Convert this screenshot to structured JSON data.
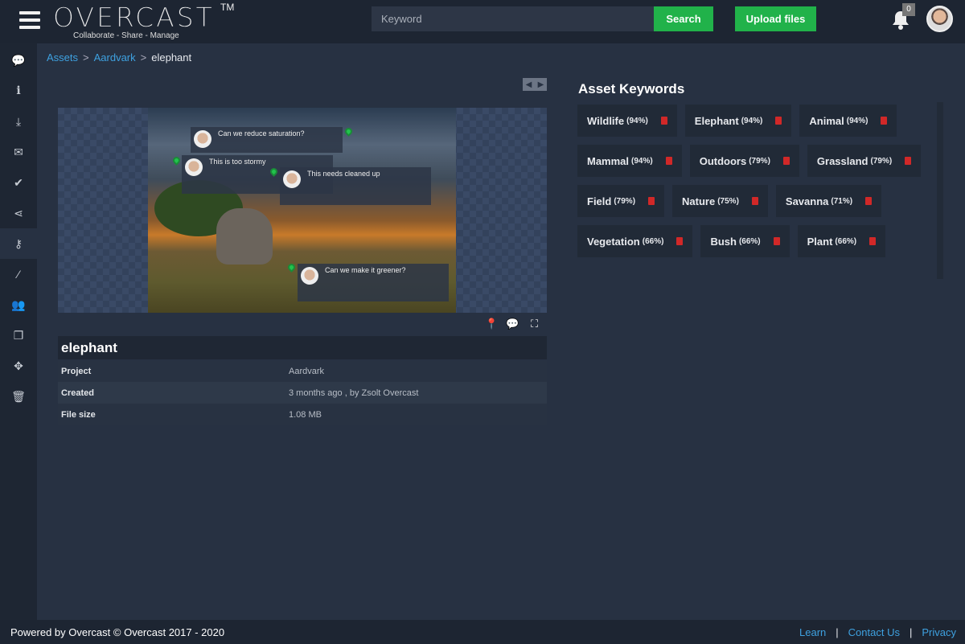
{
  "header": {
    "logo": "OVERCAST",
    "tm": "TM",
    "tagline": "Collaborate - Share - Manage",
    "search_placeholder": "Keyword",
    "search_label": "Search",
    "upload_label": "Upload files",
    "notifications": "0"
  },
  "sidebar": {
    "items": [
      "comments",
      "info",
      "download",
      "email",
      "approve",
      "share",
      "key",
      "magic",
      "users",
      "copy",
      "move",
      "delete"
    ]
  },
  "breadcrumb": [
    "Assets",
    "Aardvark",
    "elephant"
  ],
  "comments": [
    {
      "text": "Can we reduce saturation?"
    },
    {
      "text": "This is too stormy"
    },
    {
      "text": "This needs cleaned up"
    },
    {
      "text": "Can we make it greener?"
    }
  ],
  "asset": {
    "title": "elephant",
    "rows": [
      {
        "label": "Project",
        "value": "Aardvark"
      },
      {
        "label": "Created",
        "value": "3 months ago , by  Zsolt Overcast"
      },
      {
        "label": "File size",
        "value": "1.08 MB"
      }
    ]
  },
  "keywords_title": "Asset Keywords",
  "keywords": [
    [
      {
        "name": "Wildlife",
        "pct": "(94%)"
      },
      {
        "name": "Elephant",
        "pct": "(94%)"
      },
      {
        "name": "Animal",
        "pct": "(94%)"
      }
    ],
    [
      {
        "name": "Mammal",
        "pct": "(94%)"
      },
      {
        "name": "Outdoors",
        "pct": "(79%)"
      },
      {
        "name": "Grassland",
        "pct": "(79%)"
      }
    ],
    [
      {
        "name": "Field",
        "pct": "(79%)"
      },
      {
        "name": "Nature",
        "pct": "(75%)"
      },
      {
        "name": "Savanna",
        "pct": "(71%)"
      }
    ],
    [
      {
        "name": "Vegetation",
        "pct": "(66%)"
      },
      {
        "name": "Bush",
        "pct": "(66%)"
      },
      {
        "name": "Plant",
        "pct": "(66%)"
      }
    ]
  ],
  "footer": {
    "powered": "Powered by Overcast  ©  Overcast  2017 - 2020",
    "learn": "Learn",
    "contact": "Contact Us",
    "privacy": "Privacy",
    "sep": "|"
  }
}
